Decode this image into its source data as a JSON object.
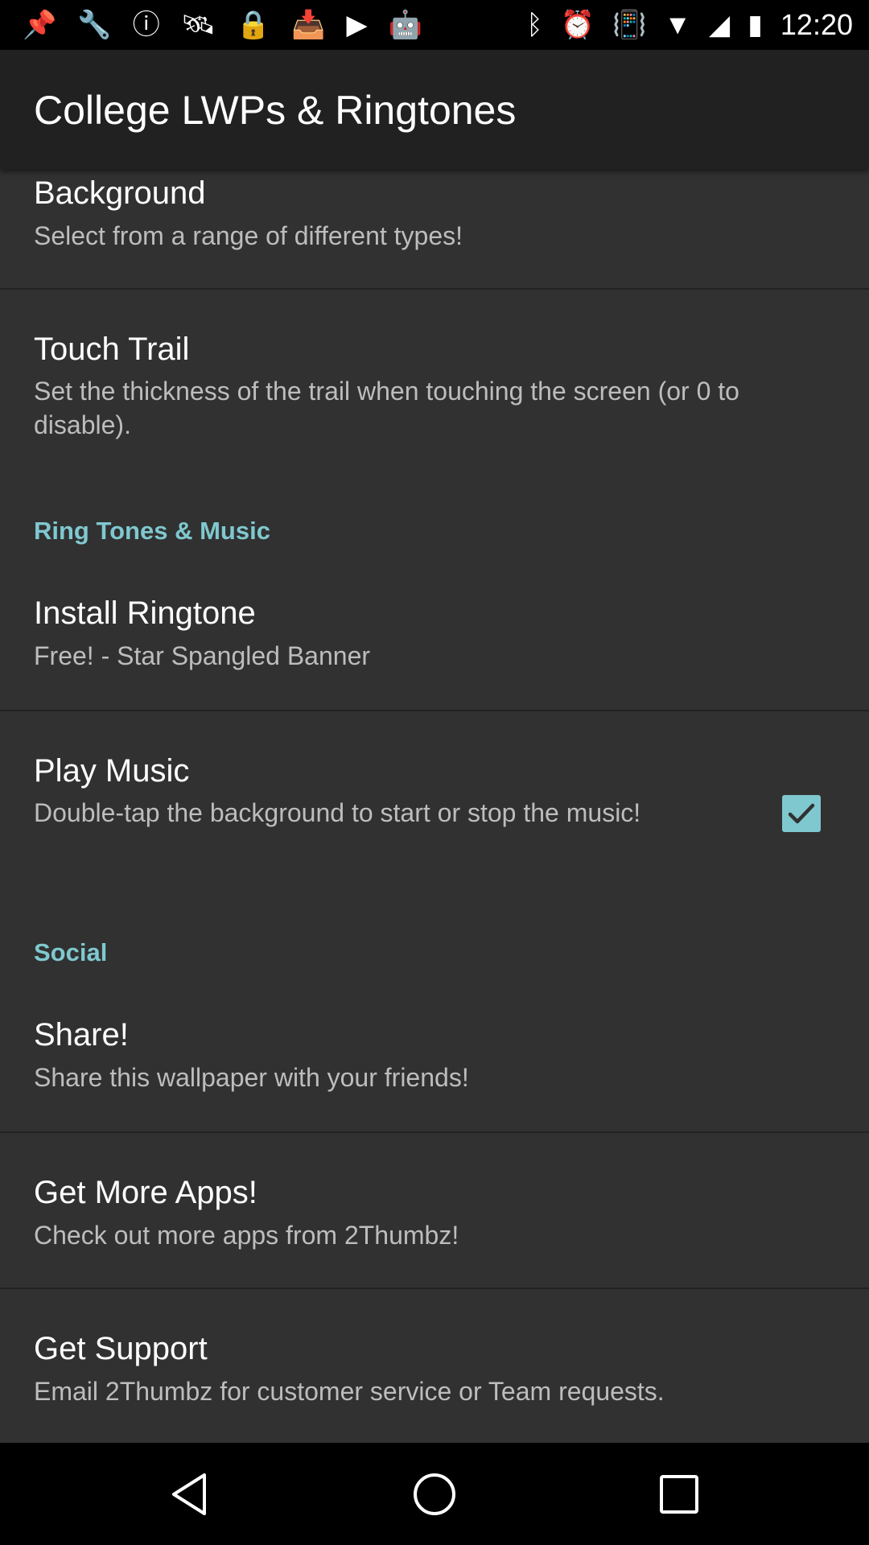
{
  "status_bar": {
    "time": "12:20",
    "left_icons": [
      "pin-icon",
      "wrench-icon",
      "alert-circle-icon",
      "fake-gps-icon",
      "lock-icon",
      "inbox-icon",
      "play-store-icon",
      "android-icon"
    ],
    "right_icons": [
      "bluetooth-icon",
      "alarm-icon",
      "vibrate-icon",
      "wifi-icon",
      "signal-icon",
      "battery-icon"
    ]
  },
  "app_bar": {
    "title": "College LWPs & Ringtones"
  },
  "preferences": {
    "background": {
      "title": "Background",
      "summary": "Select from a range of different types!"
    },
    "touch_trail": {
      "title": "Touch Trail",
      "summary": "Set the thickness of the trail when touching the screen (or 0 to disable)."
    },
    "ringtones_category": "Ring Tones & Music",
    "install_ringtone": {
      "title": "Install Ringtone",
      "summary": "Free! - Star Spangled Banner"
    },
    "play_music": {
      "title": "Play Music",
      "summary": "Double-tap the background to start or stop the music!",
      "checked": true
    },
    "social_category": "Social",
    "share": {
      "title": "Share!",
      "summary": "Share this wallpaper with your friends!"
    },
    "more_apps": {
      "title": "Get More Apps!",
      "summary": "Check out more apps from 2Thumbz!"
    },
    "support": {
      "title": "Get Support",
      "summary": "Email 2Thumbz for customer service or Team requests."
    }
  },
  "nav_bar": {
    "buttons": [
      "back-icon",
      "home-icon",
      "recents-icon"
    ]
  },
  "colors": {
    "accent": "#7fc8cf",
    "background": "#313131",
    "app_bar": "#212121"
  }
}
